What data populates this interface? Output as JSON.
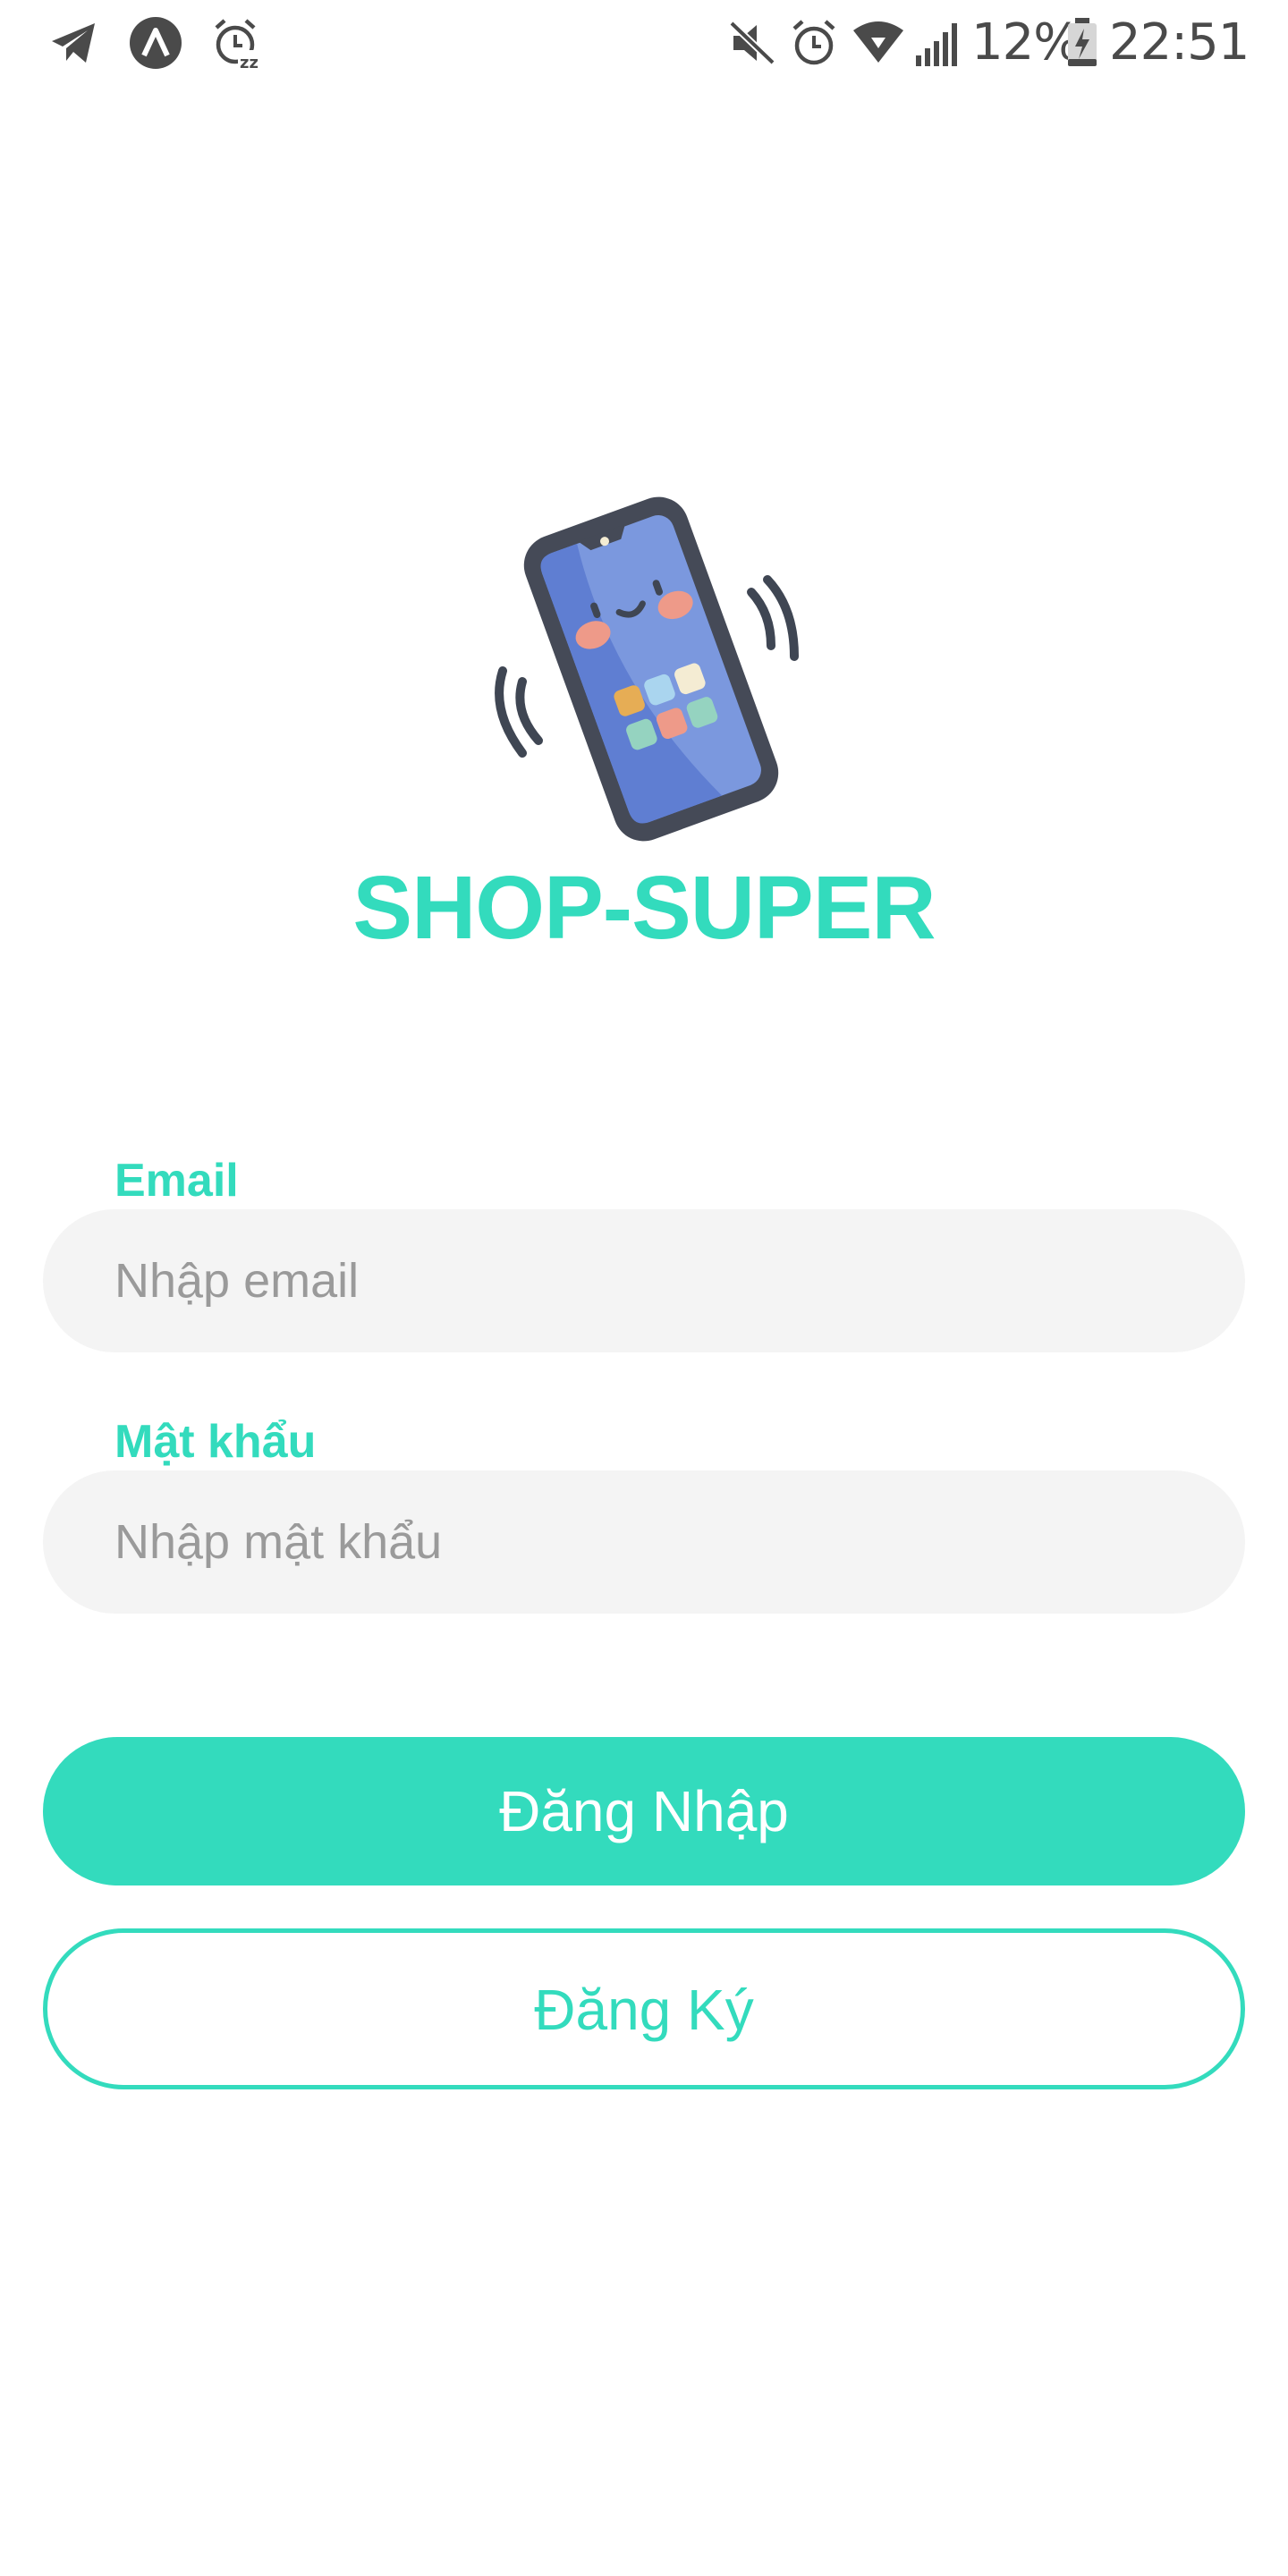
{
  "status_bar": {
    "left_icons": [
      "telegram-icon",
      "app-a-icon",
      "alarm-snooze-icon"
    ],
    "right_icons": [
      "mute-icon",
      "alarm-icon",
      "wifi-icon",
      "signal-icon",
      "battery-charging-icon"
    ],
    "battery_percent": "12%",
    "time": "22:51"
  },
  "logo": {
    "icon": "vibrating-phone-icon",
    "title": "SHOP-SUPER"
  },
  "form": {
    "email_label": "Email",
    "email_placeholder": "Nhập email",
    "email_value": "",
    "password_label": "Mật khẩu",
    "password_placeholder": "Nhập mật khẩu",
    "password_value": ""
  },
  "buttons": {
    "login_label": "Đăng Nhập",
    "register_label": "Đăng Ký"
  },
  "colors": {
    "accent": "#33dbbd",
    "input_background": "#f4f4f4",
    "status_icon": "#4a4a4a"
  }
}
